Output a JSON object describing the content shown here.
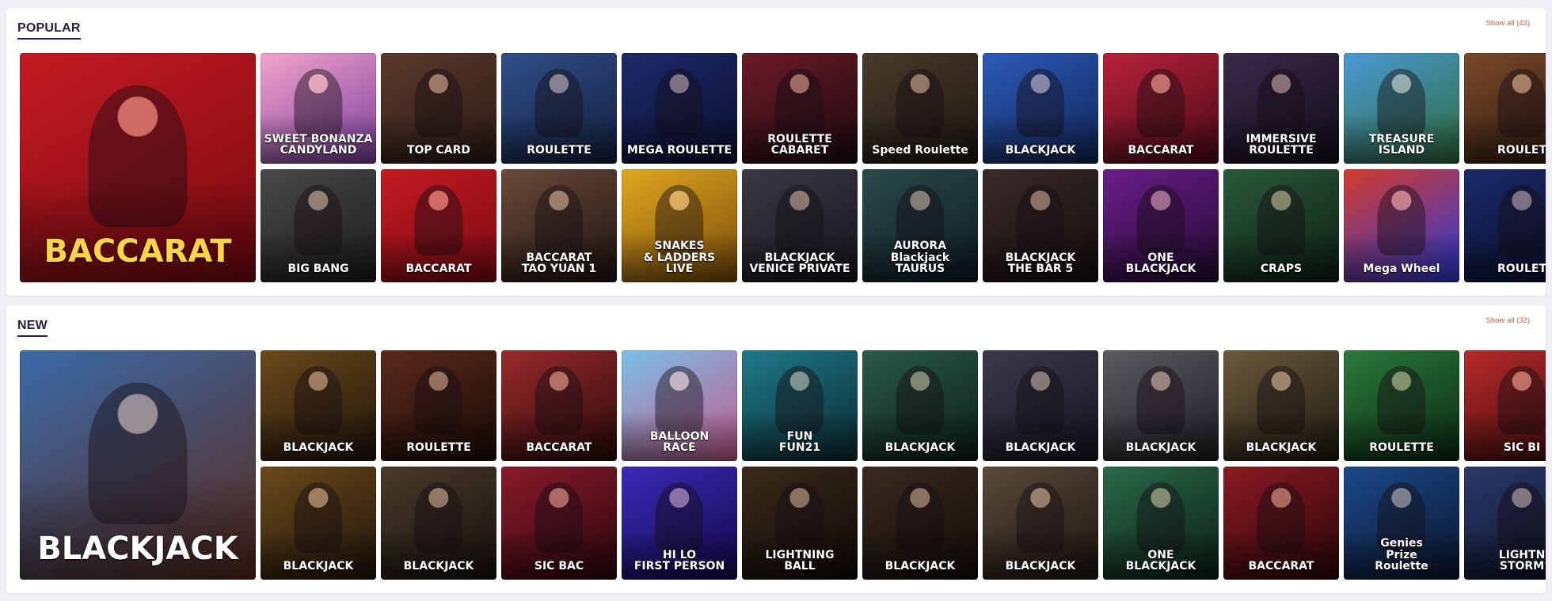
{
  "sections": [
    {
      "id": "popular",
      "title": "POPULAR",
      "show_all": "Show all (43)",
      "featured": {
        "label": "BACCARAT",
        "bg": [
          "#c41a22",
          "#7a0a10"
        ],
        "accent": "#ffd34a"
      },
      "top_row": [
        {
          "label": "SWEET BONANZA\nCANDYLAND",
          "bg": [
            "#f3a4c9",
            "#7a3f9e"
          ]
        },
        {
          "label": "TOP CARD",
          "bg": [
            "#5b3a2b",
            "#2a1a14"
          ]
        },
        {
          "label": "ROULETTE",
          "bg": [
            "#2f4f8a",
            "#12203d"
          ]
        },
        {
          "label": "MEGA ROULETTE",
          "bg": [
            "#1c2a6b",
            "#0a0f2e"
          ]
        },
        {
          "label": "ROULETTE\nCABARET",
          "bg": [
            "#6d1a28",
            "#1a0a0e"
          ]
        },
        {
          "label": "Speed Roulette",
          "bg": [
            "#4a3a2a",
            "#1c1610"
          ]
        },
        {
          "label": "BLACKJACK",
          "bg": [
            "#2c5bb8",
            "#0f2557"
          ]
        },
        {
          "label": "BACCARAT",
          "bg": [
            "#b8223a",
            "#4a0a16"
          ]
        },
        {
          "label": "IMMERSIVE\nROULETTE",
          "bg": [
            "#3a2a4a",
            "#120c1a"
          ]
        },
        {
          "label": "TREASURE\nISLAND",
          "bg": [
            "#4a9ad6",
            "#2d6b3a"
          ]
        },
        {
          "label": "ROULET",
          "bg": [
            "#7a4a2a",
            "#2a160c"
          ]
        }
      ],
      "bottom_row": [
        {
          "label": "BIG BANG",
          "bg": [
            "#4a4a4a",
            "#1a1a1a"
          ]
        },
        {
          "label": "BACCARAT",
          "bg": [
            "#c41a22",
            "#7a0a10"
          ]
        },
        {
          "label": "BACCARAT\nTAO YUAN 1",
          "bg": [
            "#6a4a3a",
            "#1e1410"
          ]
        },
        {
          "label": "SNAKES\n& LADDERS\nLIVE",
          "bg": [
            "#e0a81e",
            "#7a4a0a"
          ]
        },
        {
          "label": "BLACKJACK\nVENICE PRIVATE",
          "bg": [
            "#3a3a46",
            "#14141a"
          ]
        },
        {
          "label": "AURORA\nBlackjack\nTAURUS",
          "bg": [
            "#2a4a4a",
            "#0c1a22"
          ]
        },
        {
          "label": "BLACKJACK\nTHE BAR 5",
          "bg": [
            "#3a2a2a",
            "#140c0c"
          ]
        },
        {
          "label": "ONE\nBLACKJACK",
          "bg": [
            "#6a1e8a",
            "#220a30"
          ]
        },
        {
          "label": "CRAPS",
          "bg": [
            "#2a5a3a",
            "#0c1e14"
          ]
        },
        {
          "label": "Mega Wheel",
          "bg": [
            "#d43a2a",
            "#2a3ad4"
          ]
        },
        {
          "label": "ROULET",
          "bg": [
            "#1a2a6a",
            "#080e2a"
          ]
        }
      ]
    },
    {
      "id": "new",
      "title": "NEW",
      "show_all": "Show all (32)",
      "featured": {
        "label": "BLACKJACK",
        "bg": [
          "#3a6aa8",
          "#5a2a1a"
        ],
        "accent": "#ffffff"
      },
      "top_row": [
        {
          "label": "BLACKJACK",
          "bg": [
            "#6a4a1a",
            "#1e140a"
          ]
        },
        {
          "label": "ROULETTE",
          "bg": [
            "#5a2a1a",
            "#1a0a06"
          ]
        },
        {
          "label": "BACCARAT",
          "bg": [
            "#9a2a2a",
            "#2a0a0a"
          ]
        },
        {
          "label": "BALLOON\nRACE",
          "bg": [
            "#7ac0e8",
            "#c05a8a"
          ]
        },
        {
          "label": "FUN\nFUN21",
          "bg": [
            "#1e7a8a",
            "#0a2a30"
          ]
        },
        {
          "label": "BLACKJACK",
          "bg": [
            "#2a5a4a",
            "#0a1e18"
          ]
        },
        {
          "label": "BLACKJACK",
          "bg": [
            "#3a3a4a",
            "#141420"
          ]
        },
        {
          "label": "BLACKJACK",
          "bg": [
            "#5a5a60",
            "#1e1e22"
          ]
        },
        {
          "label": "BLACKJACK",
          "bg": [
            "#6a5a3a",
            "#1e1a10"
          ]
        },
        {
          "label": "ROULETTE",
          "bg": [
            "#2a7a3a",
            "#0a2a12"
          ]
        },
        {
          "label": "SIC BI",
          "bg": [
            "#b82a2a",
            "#3a0a0a"
          ]
        }
      ],
      "bottom_row": [
        {
          "label": "BLACKJACK",
          "bg": [
            "#6a4a1a",
            "#1e140a"
          ]
        },
        {
          "label": "BLACKJACK",
          "bg": [
            "#4a3a2a",
            "#14100c"
          ]
        },
        {
          "label": "SIC BAC",
          "bg": [
            "#8a1a2a",
            "#2a060c"
          ]
        },
        {
          "label": "HI LO\nFIRST PERSON",
          "bg": [
            "#3a2ab8",
            "#12084a"
          ]
        },
        {
          "label": "LIGHTNING\nBALL",
          "bg": [
            "#3a2a1a",
            "#0e0a06"
          ]
        },
        {
          "label": "BLACKJACK",
          "bg": [
            "#3a2a1e",
            "#120c08"
          ]
        },
        {
          "label": "BLACKJACK",
          "bg": [
            "#5a4a3a",
            "#1a140e"
          ]
        },
        {
          "label": "ONE\nBLACKJACK",
          "bg": [
            "#2a6a4a",
            "#0a1e14"
          ]
        },
        {
          "label": "BACCARAT",
          "bg": [
            "#8a1a22",
            "#2a0608"
          ]
        },
        {
          "label": "Genies\nPrize\nRoulette",
          "bg": [
            "#1a4a8a",
            "#0a142a"
          ]
        },
        {
          "label": "LIGHTN\nSTORM",
          "bg": [
            "#2a3a6a",
            "#0a0e22"
          ]
        }
      ]
    }
  ]
}
